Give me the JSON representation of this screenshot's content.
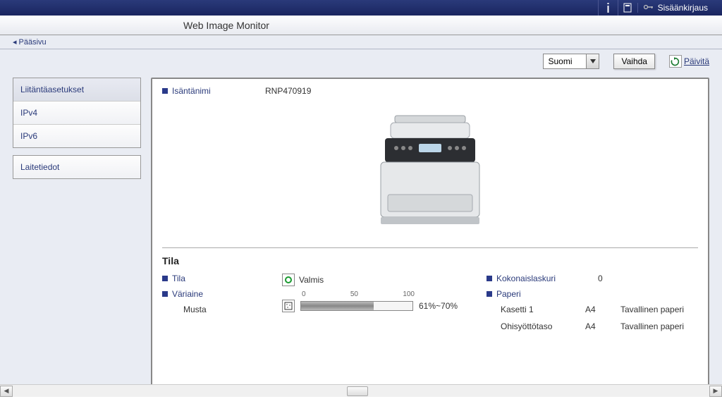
{
  "topbar": {
    "login_label": "Sisäänkirjaus"
  },
  "title": "Web Image Monitor",
  "breadcrumb": {
    "home": "Pääsivu"
  },
  "toolbar": {
    "language_selected": "Suomi",
    "switch_label": "Vaihda",
    "refresh_label": "Päivitä"
  },
  "sidebar": {
    "group1": [
      {
        "label": "Liitäntäasetukset"
      },
      {
        "label": "IPv4"
      },
      {
        "label": "IPv6"
      }
    ],
    "group2": [
      {
        "label": "Laitetiedot"
      }
    ]
  },
  "host": {
    "label": "Isäntänimi",
    "value": "RNP470919"
  },
  "status": {
    "section_title": "Tila",
    "state_label": "Tila",
    "state_value": "Valmis",
    "toner_label": "Väriaine",
    "toner_color": "Musta",
    "toner_scale": {
      "min": "0",
      "mid": "50",
      "max": "100"
    },
    "toner_pct": "61%~70%",
    "counter_label": "Kokonaislaskuri",
    "counter_value": "0",
    "paper_label": "Paperi",
    "paper_rows": [
      {
        "tray": "Kasetti 1",
        "size": "A4",
        "type": "Tavallinen paperi"
      },
      {
        "tray": "Ohisyöttötaso",
        "size": "A4",
        "type": "Tavallinen paperi"
      }
    ]
  }
}
